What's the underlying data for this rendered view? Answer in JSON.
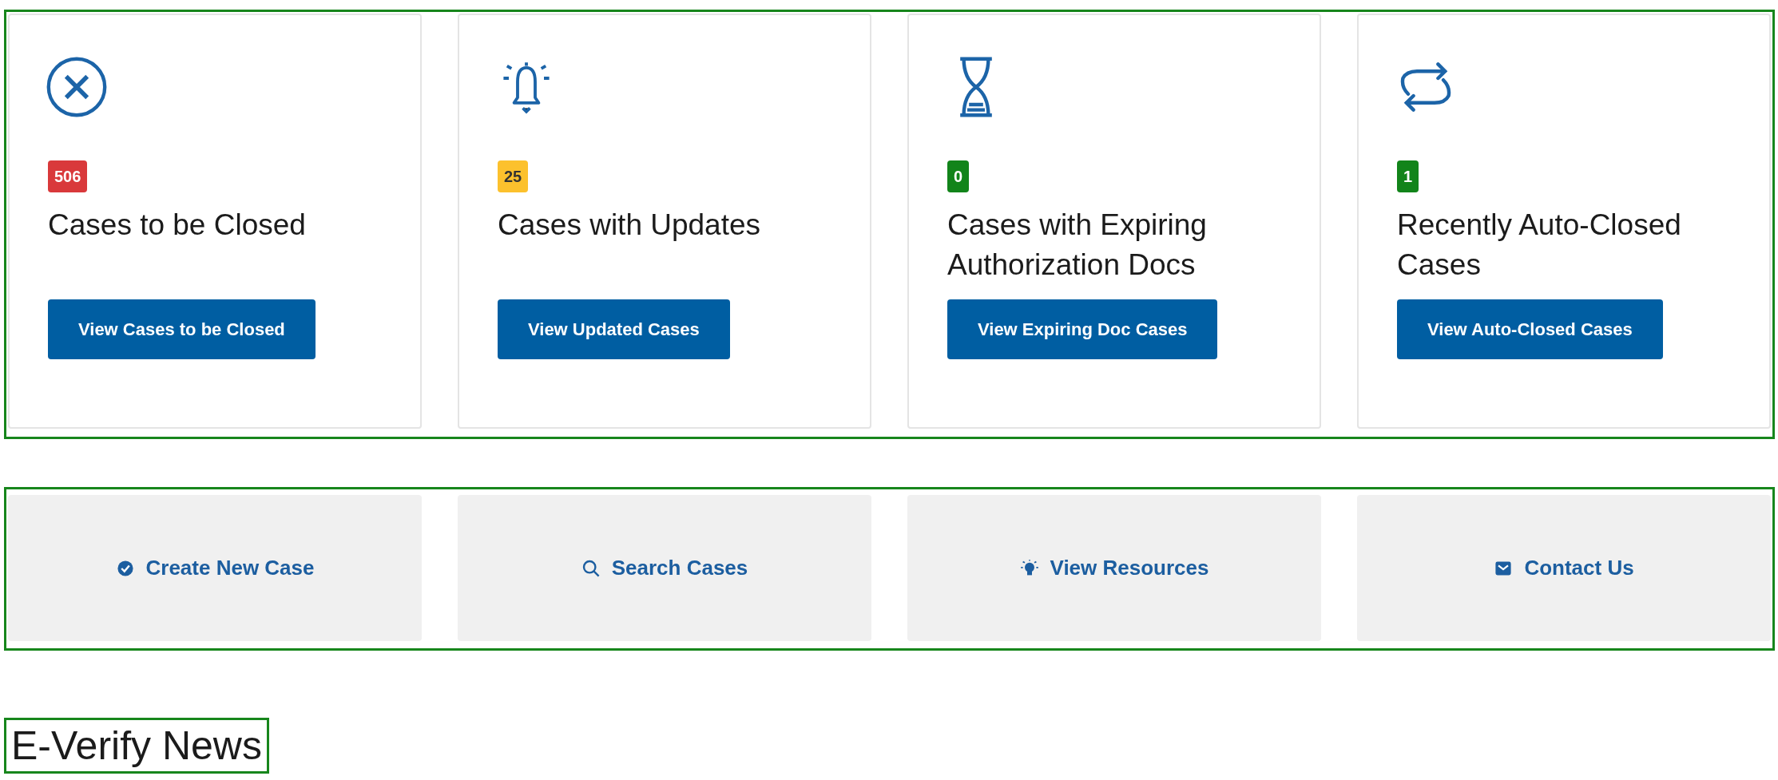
{
  "summary_cards": [
    {
      "count": "506",
      "color": "#d9393b",
      "title": "Cases to be Closed",
      "button": "View Cases to be Closed"
    },
    {
      "count": "25",
      "color": "#fcc12d",
      "title": "Cases with Updates",
      "button": "View Updated Cases"
    },
    {
      "count": "0",
      "color": "#12841a",
      "title": "Cases with Expiring Authorization Docs",
      "button": "View Expiring Doc Cases"
    },
    {
      "count": "1",
      "color": "#12841a",
      "title": "Recently Auto-Closed Cases",
      "button": "View Auto-Closed Cases"
    }
  ],
  "quick_links": [
    "Create New Case",
    "Search Cases",
    "View Resources",
    "Contact Us"
  ],
  "news": {
    "heading": "E-Verify News"
  }
}
